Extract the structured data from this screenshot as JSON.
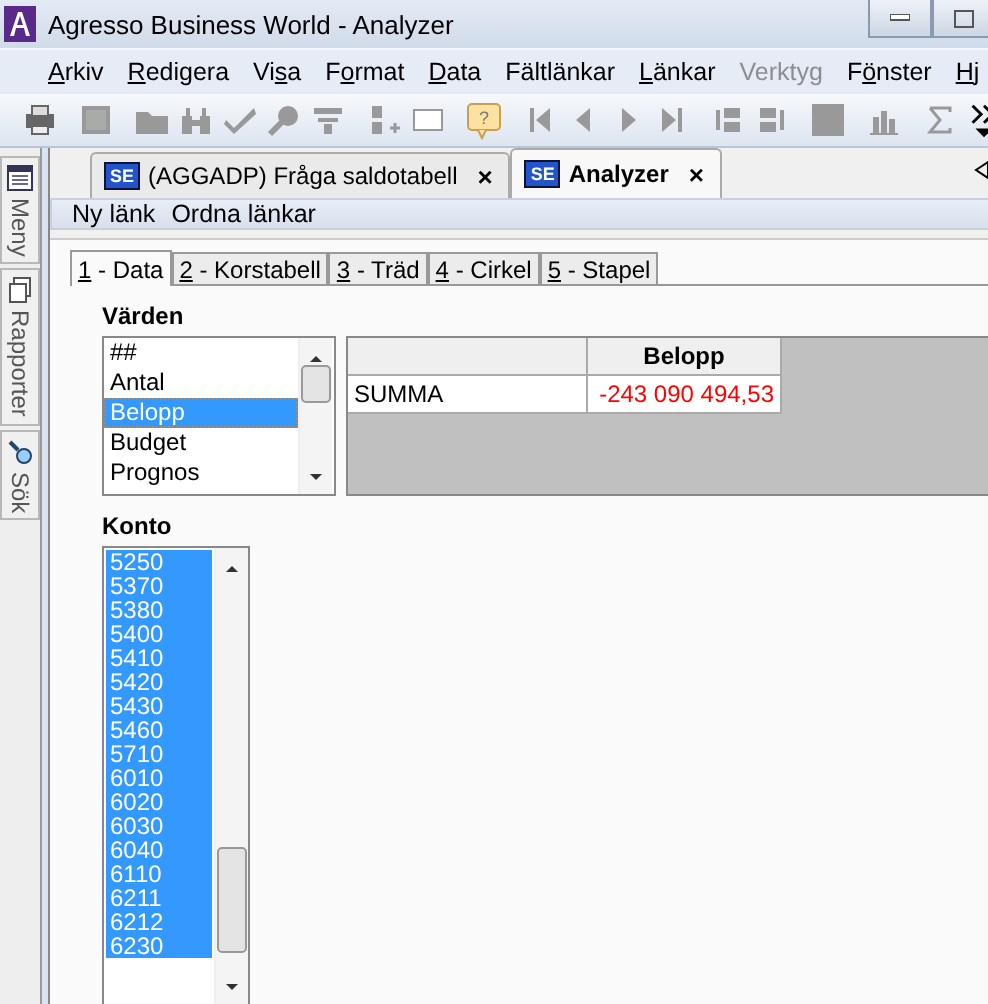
{
  "window": {
    "title": "Agresso Business World - Analyzer"
  },
  "menu": [
    {
      "accel": "A",
      "after": "rkiv",
      "disabled": false
    },
    {
      "accel": "R",
      "after": "edigera",
      "disabled": false
    },
    {
      "before": "Vi",
      "accel": "s",
      "after": "a",
      "disabled": false
    },
    {
      "before": "F",
      "accel": "o",
      "after": "rmat",
      "disabled": false
    },
    {
      "accel": "D",
      "after": "ata",
      "disabled": false
    },
    {
      "before": "Fältlänkar",
      "disabled": false
    },
    {
      "accel": "L",
      "after": "änkar",
      "disabled": false
    },
    {
      "before": "Verktyg",
      "disabled": true
    },
    {
      "before": "F",
      "accel": "ö",
      "after": "nster",
      "disabled": false
    },
    {
      "accel": "H",
      "after": "j",
      "disabled": false
    }
  ],
  "toolbar": {
    "help_mark": "?"
  },
  "side_tabs": [
    {
      "label": "Meny"
    },
    {
      "label": "Rapporter"
    },
    {
      "label": "Sök"
    }
  ],
  "doc_tabs": [
    {
      "icon": "SE",
      "label": "(AGGADP) Fråga saldotabell",
      "close": "×",
      "selected": false
    },
    {
      "icon": "SE",
      "label": "Analyzer",
      "close": "×",
      "selected": true
    }
  ],
  "links": [
    "Ny länk",
    "Ordna länkar"
  ],
  "tabs": [
    {
      "accel": "1",
      "label": " - Data",
      "selected": true
    },
    {
      "accel": "2",
      "label": " - Korstabell",
      "selected": false
    },
    {
      "accel": "3",
      "label": " - Träd",
      "selected": false
    },
    {
      "accel": "4",
      "label": " - Cirkel",
      "selected": false
    },
    {
      "accel": "5",
      "label": " - Stapel",
      "selected": false
    }
  ],
  "values": {
    "title": "Värden",
    "items": [
      {
        "label": "##",
        "selected": false
      },
      {
        "label": "Antal",
        "selected": false
      },
      {
        "label": "Belopp",
        "selected": true
      },
      {
        "label": "Budget",
        "selected": false
      },
      {
        "label": "Prognos",
        "selected": false
      }
    ]
  },
  "table": {
    "columns": [
      "Belopp"
    ],
    "rows": [
      {
        "label": "SUMMA",
        "value": "-243 090 494,53",
        "negative": true
      }
    ]
  },
  "konto": {
    "title": "Konto",
    "items": [
      {
        "label": "5250",
        "selected": true
      },
      {
        "label": "5370",
        "selected": true
      },
      {
        "label": "5380",
        "selected": true
      },
      {
        "label": "5400",
        "selected": true
      },
      {
        "label": "5410",
        "selected": true
      },
      {
        "label": "5420",
        "selected": true
      },
      {
        "label": "5430",
        "selected": true
      },
      {
        "label": "5460",
        "selected": true
      },
      {
        "label": "5710",
        "selected": true
      },
      {
        "label": "6010",
        "selected": true
      },
      {
        "label": "6020",
        "selected": true
      },
      {
        "label": "6030",
        "selected": true
      },
      {
        "label": "6040",
        "selected": true
      },
      {
        "label": "6110",
        "selected": true
      },
      {
        "label": "6211",
        "selected": true
      },
      {
        "label": "6212",
        "selected": true
      },
      {
        "label": "6230",
        "selected": true
      }
    ]
  }
}
